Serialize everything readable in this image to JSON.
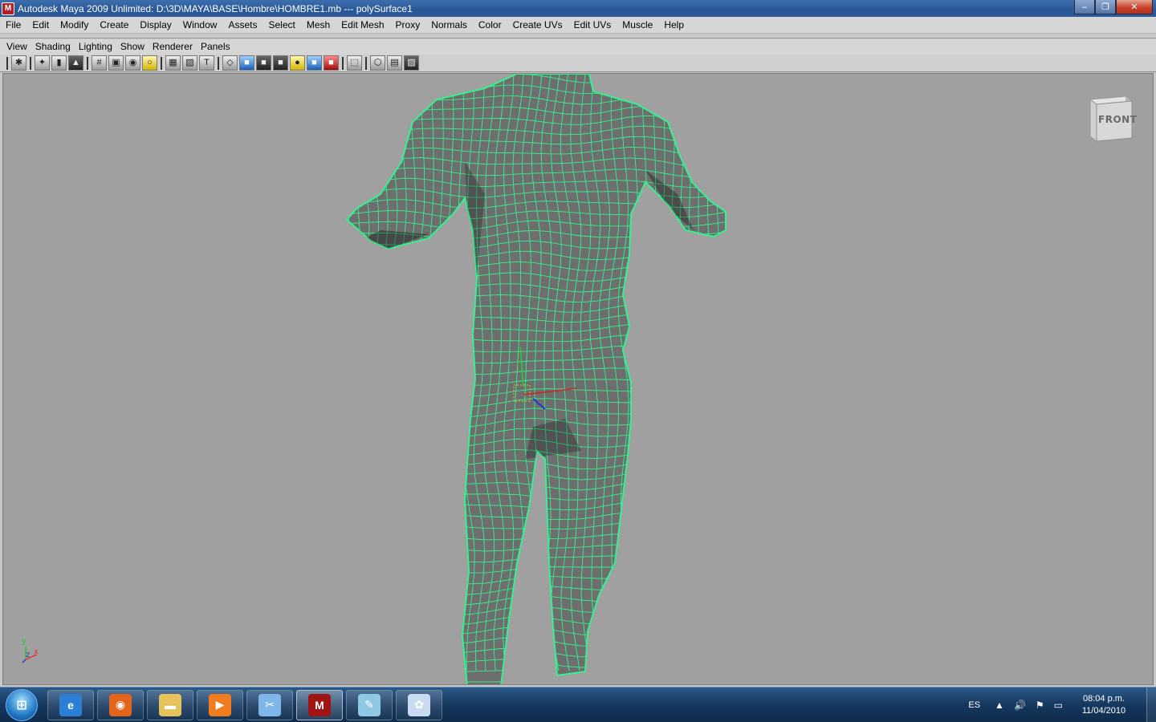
{
  "window": {
    "title": "Autodesk Maya 2009 Unlimited: D:\\3D\\MAYA\\BASE\\Hombre\\HOMBRE1.mb   ---   polySurface1",
    "min_glyph": "–",
    "max_glyph": "❐",
    "close_glyph": "✕",
    "app_icon_glyph": "M"
  },
  "main_menu": [
    "File",
    "Edit",
    "Modify",
    "Create",
    "Display",
    "Window",
    "Assets",
    "Select",
    "Mesh",
    "Edit Mesh",
    "Proxy",
    "Normals",
    "Color",
    "Create UVs",
    "Edit UVs",
    "Muscle",
    "Help"
  ],
  "panel_menu": [
    "View",
    "Shading",
    "Lighting",
    "Show",
    "Renderer",
    "Panels"
  ],
  "toolbar_icons": [
    {
      "name": "select-camera-icon",
      "glyph": "✱",
      "style": ""
    },
    {
      "name": "camera-attributes-icon",
      "glyph": "✦",
      "style": ""
    },
    {
      "name": "bookmark-icon",
      "glyph": "▮",
      "style": ""
    },
    {
      "name": "image-plane-icon",
      "glyph": "▲",
      "style": "dark"
    },
    {
      "name": "grid-icon",
      "glyph": "#",
      "style": ""
    },
    {
      "name": "film-gate-icon",
      "glyph": "▣",
      "style": ""
    },
    {
      "name": "resolution-gate-icon",
      "glyph": "◉",
      "style": ""
    },
    {
      "name": "gate-mask-icon",
      "glyph": "○",
      "style": "yellow"
    },
    {
      "name": "field-chart-icon",
      "glyph": "▦",
      "style": ""
    },
    {
      "name": "safe-action-icon",
      "glyph": "▧",
      "style": ""
    },
    {
      "name": "safe-title-icon",
      "glyph": "T",
      "style": ""
    },
    {
      "name": "wireframe-icon",
      "glyph": "◇",
      "style": ""
    },
    {
      "name": "smooth-shade-icon",
      "glyph": "■",
      "style": "blue"
    },
    {
      "name": "wireframe-on-shaded-icon",
      "glyph": "■",
      "style": "dark"
    },
    {
      "name": "textured-icon",
      "glyph": "■",
      "style": "dark"
    },
    {
      "name": "use-lights-icon",
      "glyph": "●",
      "style": "yellow"
    },
    {
      "name": "shadows-icon",
      "glyph": "■",
      "style": "blue"
    },
    {
      "name": "xray-icon",
      "glyph": "■",
      "style": "red"
    },
    {
      "name": "isolate-select-icon",
      "glyph": "⬚",
      "style": ""
    },
    {
      "name": "two-sided-icon",
      "glyph": "⬡",
      "style": ""
    },
    {
      "name": "high-quality-icon",
      "glyph": "▤",
      "style": ""
    },
    {
      "name": "hud-icon",
      "glyph": "▨",
      "style": "dark"
    }
  ],
  "viewport": {
    "viewcube_label": "FRONT",
    "axis_y": "y",
    "axis_z": "z",
    "axis_x": "x",
    "background": "#a0a0a0",
    "wire_color": "#36f08f",
    "surface_color": "#6e6e6e"
  },
  "taskbar": {
    "start_glyph": "⊞",
    "apps": [
      {
        "name": "internet-explorer-icon",
        "glyph": "e",
        "color": "#2b7fd4"
      },
      {
        "name": "firefox-icon",
        "glyph": "◉",
        "color": "#e2651b"
      },
      {
        "name": "explorer-folder-icon",
        "glyph": "▬",
        "color": "#e6c25a"
      },
      {
        "name": "media-player-icon",
        "glyph": "▶",
        "color": "#f07c1e"
      },
      {
        "name": "tool-app-icon",
        "glyph": "✂",
        "color": "#7fb8e8"
      },
      {
        "name": "maya-icon",
        "glyph": "M",
        "color": "#a01414"
      },
      {
        "name": "notepad-icon",
        "glyph": "✎",
        "color": "#8fc8e4"
      },
      {
        "name": "paint-icon",
        "glyph": "✿",
        "color": "#c9dcef"
      }
    ],
    "language": "ES",
    "tray_up": "▲",
    "tray_volume": "🔊",
    "tray_flag": "⚑",
    "tray_network": "▭",
    "time": "08:04 p.m.",
    "date": "11/04/2010"
  }
}
